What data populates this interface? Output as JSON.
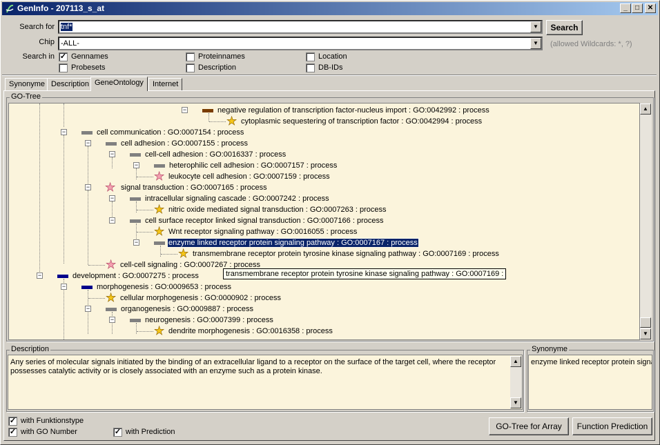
{
  "window": {
    "title": "GenInfo - 207113_s_at"
  },
  "search": {
    "label": "Search for",
    "value": "tnf*",
    "chip_label": "Chip",
    "chip_value": "-ALL-",
    "search_in_label": "Search in",
    "button": "Search",
    "wildcards_hint": "(allowed Wildcards: *, ?)",
    "options": [
      {
        "label": "Gennames",
        "checked": true
      },
      {
        "label": "Proteinnames",
        "checked": false
      },
      {
        "label": "Location",
        "checked": false
      },
      {
        "label": "Probesets",
        "checked": false
      },
      {
        "label": "Description",
        "checked": false
      },
      {
        "label": "DB-IDs",
        "checked": false
      }
    ]
  },
  "tabs": [
    {
      "label": "Synonyme"
    },
    {
      "label": "Description"
    },
    {
      "label": "GeneOntology",
      "active": true
    },
    {
      "label": "Internet"
    }
  ],
  "gotree": {
    "label": "GO-Tree",
    "nodes": [
      {
        "text": "negative regulation of transcription factor-nucleus import : GO:0042992 : process",
        "icon": "brown-bar"
      },
      {
        "text": "cytoplasmic sequestering of transcription factor : GO:0042994 : process",
        "icon": "yellow-star"
      },
      {
        "text": "cell communication : GO:0007154 : process",
        "icon": "gray-bar"
      },
      {
        "text": "cell adhesion : GO:0007155 : process",
        "icon": "gray-bar"
      },
      {
        "text": "cell-cell adhesion : GO:0016337 : process",
        "icon": "gray-bar"
      },
      {
        "text": "heterophilic cell adhesion : GO:0007157 : process",
        "icon": "gray-bar"
      },
      {
        "text": "leukocyte cell adhesion : GO:0007159 : process",
        "icon": "pink-star"
      },
      {
        "text": "signal transduction : GO:0007165 : process",
        "icon": "pink-star"
      },
      {
        "text": "intracellular signaling cascade : GO:0007242 : process",
        "icon": "gray-bar"
      },
      {
        "text": "nitric oxide mediated signal transduction : GO:0007263 : process",
        "icon": "yellow-star"
      },
      {
        "text": "cell surface receptor linked signal transduction : GO:0007166 : process",
        "icon": "gray-bar"
      },
      {
        "text": "Wnt receptor signaling pathway : GO:0016055 : process",
        "icon": "yellow-star"
      },
      {
        "text": "enzyme linked receptor protein signaling pathway : GO:0007167 : process",
        "icon": "gray-bar",
        "selected": true
      },
      {
        "text": "transmembrane receptor protein tyrosine kinase signaling pathway : GO:0007169 : process",
        "icon": "yellow-star"
      },
      {
        "text": "cell-cell signaling : GO:0007267 : process",
        "icon": "pink-star"
      },
      {
        "text": "development : GO:0007275 : process",
        "icon": "navy-bar"
      },
      {
        "text": "morphogenesis : GO:0009653 : process",
        "icon": "navy-bar"
      },
      {
        "text": "cellular morphogenesis : GO:0000902 : process",
        "icon": "yellow-star"
      },
      {
        "text": "organogenesis : GO:0009887 : process",
        "icon": "gray-bar"
      },
      {
        "text": "neurogenesis : GO:0007399 : process",
        "icon": "gray-bar"
      },
      {
        "text": "dendrite morphogenesis : GO:0016358 : process",
        "icon": "yellow-star"
      }
    ],
    "tooltip": "transmembrane receptor protein tyrosine kinase signaling pathway : GO:0007169 :"
  },
  "description": {
    "label": "Description",
    "text": "Any series of molecular signals initiated by the binding of an extracellular ligand to a receptor on the surface of the target cell, where the receptor possesses catalytic activity or is closely associated with an enzyme such as a protein kinase."
  },
  "synonyme": {
    "label": "Synonyme",
    "text": "enzyme linked receptor protein signal"
  },
  "footer": {
    "options": [
      {
        "label": "with Funktionstype",
        "checked": true
      },
      {
        "label": "with GO Number",
        "checked": true
      },
      {
        "label": "with Prediction",
        "checked": true
      }
    ],
    "go_tree_button": "GO-Tree for Array",
    "function_prediction_button": "Function Prediction"
  },
  "colors": {
    "tree_bg": "#fbf4dc",
    "selection": "#0a246a",
    "brown_bar": "#7a3c00",
    "navy_bar": "#00008b",
    "gray_bar": "#808080",
    "yellow_star": "#f5c518",
    "pink_star": "#f4a0b0"
  }
}
